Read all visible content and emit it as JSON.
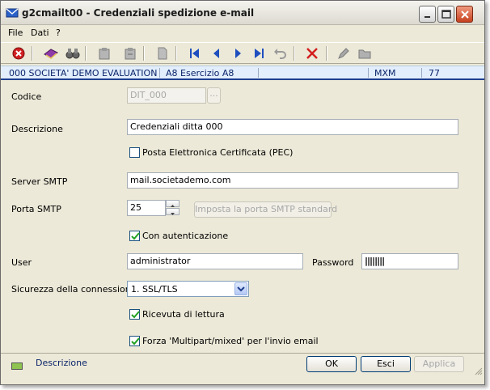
{
  "window": {
    "title": "g2cmailt00 - Credenziali spedizione e-mail"
  },
  "menu": {
    "items": [
      "File",
      "Dati",
      "?"
    ]
  },
  "toolbar": {
    "icons": [
      "close-red-icon",
      "book-icon",
      "binoculars-icon",
      "clipboard-icon",
      "clipboard-copy-icon",
      "page-icon",
      "first-record-icon",
      "prev-record-icon",
      "next-record-icon",
      "last-record-icon",
      "undo-icon",
      "delete-x-icon",
      "pencil-icon",
      "folder-icon"
    ]
  },
  "status": {
    "company": "000 SOCIETA' DEMO EVALUATION",
    "year": "A8 Esercizio A8",
    "user": "MXM",
    "number": "77"
  },
  "form": {
    "codice_label": "Codice",
    "codice_value": "DIT_000",
    "codice_lookup": "...",
    "descrizione_label": "Descrizione",
    "descrizione_value": "Credenziali ditta 000",
    "pec_label": "Posta Elettronica Certificata (PEC)",
    "pec_checked": false,
    "server_label": "Server SMTP",
    "server_value": "mail.societademo.com",
    "porta_label": "Porta SMTP",
    "porta_value": "25",
    "porta_default_button": "Imposta la porta SMTP standard",
    "auth_label": "Con autenticazione",
    "auth_checked": true,
    "user_label": "User",
    "user_value": "administrator",
    "password_label": "Password",
    "password_value": "||||||||",
    "security_label": "Sicurezza della connessione",
    "security_value": "1. SSL/TLS",
    "receipt_label": "Ricevuta di lettura",
    "receipt_checked": true,
    "multipart_label": "Forza 'Multipart/mixed' per l'invio email",
    "multipart_checked": true
  },
  "footer": {
    "description": "Descrizione",
    "ok": "OK",
    "esci": "Esci",
    "applica": "Applica"
  },
  "colors": {
    "status_bg": "#e2eefc",
    "status_border": "#1f3f8f",
    "window_bg": "#ece9d8"
  }
}
